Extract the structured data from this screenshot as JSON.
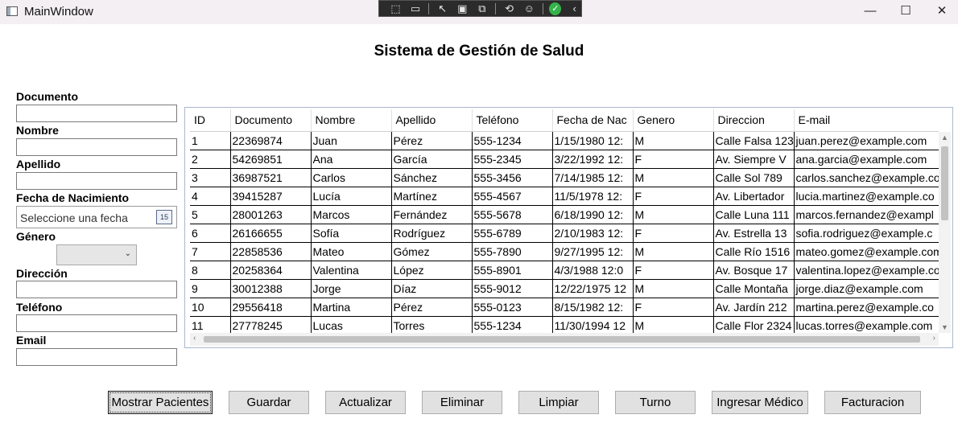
{
  "window": {
    "title": "MainWindow",
    "minimize": "—",
    "maximize": "☐",
    "close": "✕"
  },
  "devtools": {
    "icons": [
      "select-element-icon",
      "video-icon",
      "pointer-icon",
      "rect-icon",
      "display-icon",
      "hot-reload-icon",
      "accessibility-icon",
      "check-icon",
      "collapse-icon"
    ]
  },
  "page": {
    "title": "Sistema de Gestión de Salud"
  },
  "form": {
    "documento_label": "Documento",
    "nombre_label": "Nombre",
    "apellido_label": "Apellido",
    "fecha_label": "Fecha de Nacimiento",
    "fecha_placeholder": "Seleccione una fecha",
    "calendar_day": "15",
    "genero_label": "Género",
    "direccion_label": "Dirección",
    "telefono_label": "Teléfono",
    "email_label": "Email"
  },
  "grid": {
    "columns": [
      "ID",
      "Documento",
      "Nombre",
      "Apellido",
      "Teléfono",
      "Fecha de Nac",
      "Genero",
      "Direccion",
      "E-mail"
    ],
    "rows": [
      [
        "1",
        "22369874",
        "Juan",
        "Pérez",
        "555-1234",
        "1/15/1980 12:",
        "M",
        "Calle Falsa 123",
        "juan.perez@example.com"
      ],
      [
        "2",
        "54269851",
        "Ana",
        "García",
        "555-2345",
        "3/22/1992 12:",
        "F",
        "Av. Siempre V",
        "ana.garcia@example.com"
      ],
      [
        "3",
        "36987521",
        "Carlos",
        "Sánchez",
        "555-3456",
        "7/14/1985 12:",
        "M",
        "Calle Sol 789",
        "carlos.sanchez@example.co"
      ],
      [
        "4",
        "39415287",
        "Lucía",
        "Martínez",
        "555-4567",
        "11/5/1978 12:",
        "F",
        "Av. Libertador",
        "lucia.martinez@example.co"
      ],
      [
        "5",
        "28001263",
        "Marcos",
        "Fernández",
        "555-5678",
        "6/18/1990 12:",
        "M",
        "Calle Luna 111",
        "marcos.fernandez@exampl"
      ],
      [
        "6",
        "26166655",
        "Sofía",
        "Rodríguez",
        "555-6789",
        "2/10/1983 12:",
        "F",
        "Av. Estrella 13",
        "sofia.rodriguez@example.c"
      ],
      [
        "7",
        "22858536",
        "Mateo",
        "Gómez",
        "555-7890",
        "9/27/1995 12:",
        "M",
        "Calle Río 1516",
        "mateo.gomez@example.com"
      ],
      [
        "8",
        "20258364",
        "Valentina",
        "López",
        "555-8901",
        "4/3/1988 12:0",
        "F",
        "Av. Bosque 17",
        "valentina.lopez@example.co"
      ],
      [
        "9",
        "30012388",
        "Jorge",
        "Díaz",
        "555-9012",
        "12/22/1975 12",
        "M",
        "Calle Montaña",
        "jorge.diaz@example.com"
      ],
      [
        "10",
        "29556418",
        "Martina",
        "Pérez",
        "555-0123",
        "8/15/1982 12:",
        "F",
        "Av. Jardín 212",
        "martina.perez@example.co"
      ],
      [
        "11",
        "27778245",
        "Lucas",
        "Torres",
        "555-1234",
        "11/30/1994 12",
        "M",
        "Calle Flor 2324",
        "lucas.torres@example.com"
      ]
    ]
  },
  "buttons": {
    "mostrar": "Mostrar Pacientes",
    "guardar": "Guardar",
    "actualizar": "Actualizar",
    "eliminar": "Eliminar",
    "limpiar": "Limpiar",
    "turno": "Turno",
    "ingresar_medico": "Ingresar Médico",
    "facturacion": "Facturacion"
  }
}
